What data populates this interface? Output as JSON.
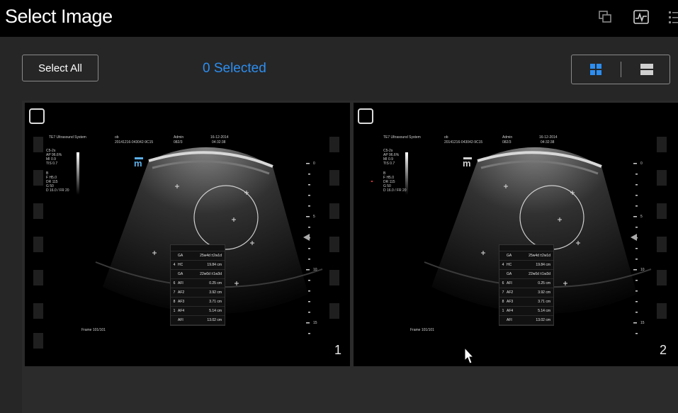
{
  "title": "Select Image",
  "toolbar": {
    "select_all": "Select All",
    "selected": "0 Selected"
  },
  "icons": [
    "copy-icon",
    "waveform-icon",
    "list-menu-icon",
    "grid-view-icon",
    "single-view-icon"
  ],
  "thumbs": [
    {
      "number": "1",
      "header": {
        "system": "TE7 Ultrasound System",
        "exam": "ob",
        "id": "20141216-043042-9C15",
        "user": "Admin",
        "code": "082/3",
        "date": "16-12-2014",
        "time": "04:32:38"
      },
      "params": [
        "C5-2s",
        "AP 96.6%",
        "MI 0.9",
        "TIS 0.7",
        "",
        "B",
        "F H5.0",
        "DR 115",
        "G 50",
        "D 16.0 / FR 20"
      ],
      "frame": "Frame 101/101",
      "meas": [
        {
          "n": "",
          "k": "GA",
          "v": "25w4d ±2w1d"
        },
        {
          "n": "4",
          "k": "HC",
          "v": "19.84 cm"
        },
        {
          "n": "",
          "k": "GA",
          "v": "22w0d ±1w3d"
        },
        {
          "n": "6",
          "k": "AFI",
          "v": "0.25 cm"
        },
        {
          "n": "7",
          "k": "AF2",
          "v": "3.92 cm"
        },
        {
          "n": "8",
          "k": "AF3",
          "v": "3.71 cm"
        },
        {
          "n": "1",
          "k": "AF4",
          "v": "5.14 cm"
        },
        {
          "n": "",
          "k": "AFI",
          "v": "13.02 cm"
        }
      ],
      "depth": [
        "0",
        "5",
        "10",
        "15"
      ]
    },
    {
      "number": "2",
      "header": {
        "system": "TE7 Ultrasound System",
        "exam": "ob",
        "id": "20141216-043042-9C15",
        "user": "Admin",
        "code": "082/3",
        "date": "16-12-2014",
        "time": "04:32:38"
      },
      "params": [
        "C5-2s",
        "AP 96.6%",
        "MI 0.9",
        "TIS 0.7",
        "",
        "B",
        "F H5.0",
        "DR 115",
        "G 50",
        "D 16.0 / FR 20"
      ],
      "frame": "Frame 101/101",
      "meas": [
        {
          "n": "",
          "k": "GA",
          "v": "25w4d ±2w1d"
        },
        {
          "n": "4",
          "k": "HC",
          "v": "19.84 cm"
        },
        {
          "n": "",
          "k": "GA",
          "v": "22w0d ±1w3d"
        },
        {
          "n": "6",
          "k": "AFI",
          "v": "0.25 cm"
        },
        {
          "n": "7",
          "k": "AF2",
          "v": "3.92 cm"
        },
        {
          "n": "8",
          "k": "AF3",
          "v": "3.71 cm"
        },
        {
          "n": "1",
          "k": "AF4",
          "v": "5.14 cm"
        },
        {
          "n": "",
          "k": "AFI",
          "v": "13.02 cm"
        }
      ],
      "depth": [
        "0",
        "5",
        "10",
        "15"
      ]
    }
  ]
}
